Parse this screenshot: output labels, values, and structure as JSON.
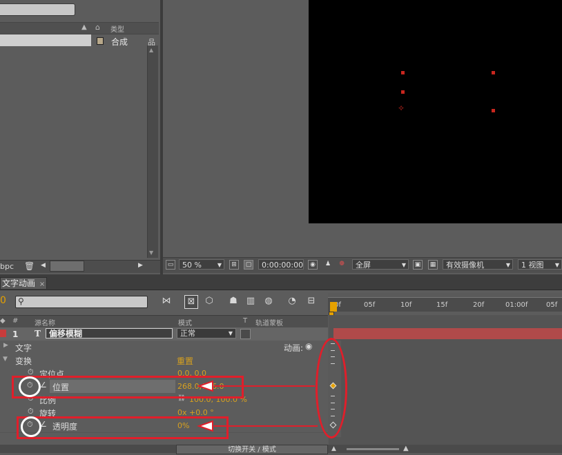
{
  "project_panel": {
    "type_col_label": "类型",
    "row_type": "合成",
    "bpc_label": "bpc"
  },
  "viewer_toolbar": {
    "zoom": "50 %",
    "timecode": "0:00:00:00",
    "resolution": "全屏",
    "camera": "有效摄像机",
    "views": "1 视图"
  },
  "timeline": {
    "tab_label": "文字动画",
    "ruler_labels": [
      "0f",
      "05f",
      "10f",
      "15f",
      "20f",
      "01:00f",
      "05f"
    ],
    "columns": {
      "hash": "#",
      "source_name": "源名称",
      "mode": "模式",
      "t": "T",
      "track_matte": "轨道蒙板"
    },
    "layer": {
      "number": "1",
      "type_glyph": "T",
      "name": "偏移模糊",
      "mode": "正常"
    },
    "groups": {
      "text": "文字",
      "animate": "动画:",
      "transform": "变换",
      "reset": "重置"
    },
    "properties": {
      "anchor": {
        "label": "定位点",
        "value": "0.0, 0.0"
      },
      "position": {
        "label": "位置",
        "value_x": "268.0,",
        "value_y": "386.0"
      },
      "scale": {
        "label": "比例",
        "value": "100.0, 100.0 %"
      },
      "rotation": {
        "label": "旋转",
        "value": "0x +0.0 °"
      },
      "opacity": {
        "label": "透明度",
        "value": "0%"
      }
    },
    "footer_toggle": "切换开关 / 模式"
  },
  "colors": {
    "annotation_red": "#e11e2a",
    "accent_orange": "#d8a11e",
    "layer_bar": "#b04a4a"
  }
}
